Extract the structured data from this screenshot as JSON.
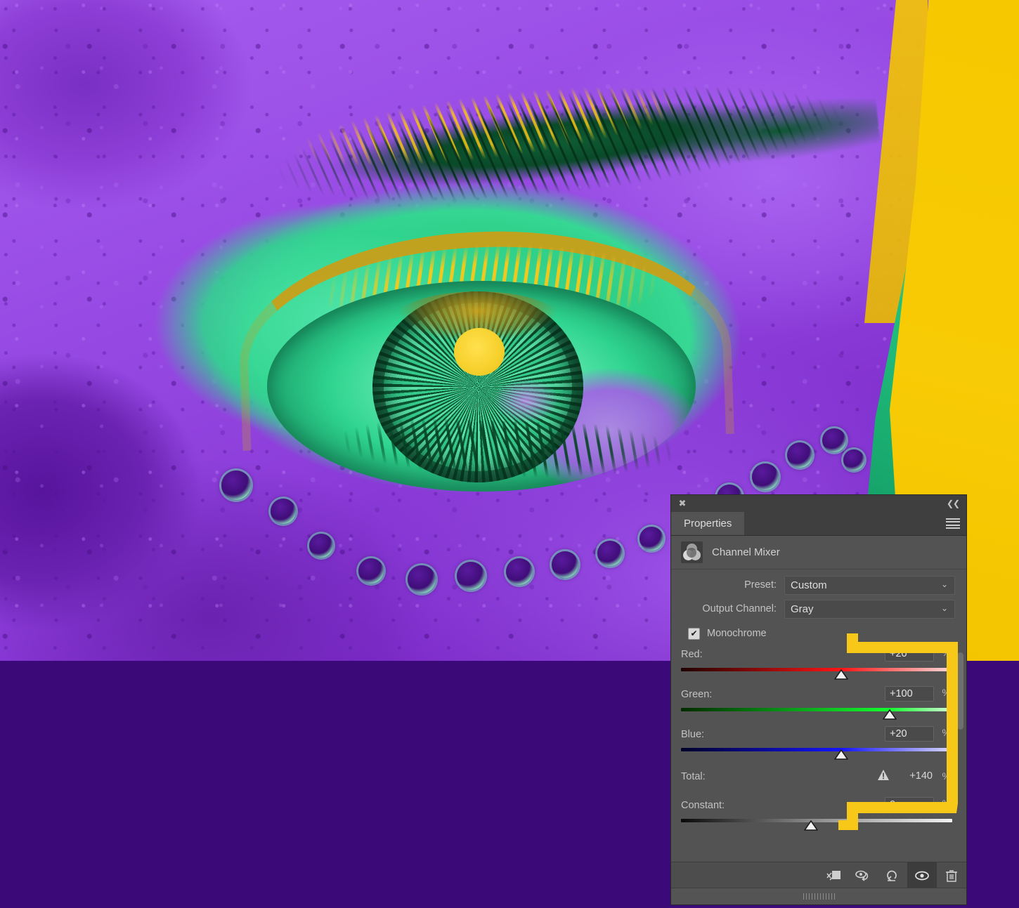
{
  "app": {
    "panel_title": "Properties",
    "close_icon": "✖",
    "collapse_icon": "❮❮",
    "menu_icon": "hamburger-menu-icon"
  },
  "adjustment": {
    "name": "Channel Mixer",
    "icon": "channel-mixer-venn-icon"
  },
  "fields": {
    "preset_label": "Preset:",
    "preset_value": "Custom",
    "output_channel_label": "Output Channel:",
    "output_channel_value": "Gray",
    "chevron": "⌄"
  },
  "monochrome": {
    "label": "Monochrome",
    "checked": true,
    "check_glyph": "✔"
  },
  "sliders": [
    {
      "label": "Red:",
      "value": "+20",
      "unit": "%",
      "percent": 59,
      "color": "#ff2b2b"
    },
    {
      "label": "Green:",
      "value": "+100",
      "unit": "%",
      "percent": 77,
      "color": "#1aff3c"
    },
    {
      "label": "Blue:",
      "value": "+20",
      "unit": "%",
      "percent": 59,
      "color": "#2b2bff"
    }
  ],
  "total": {
    "label": "Total:",
    "value": "+140",
    "unit": "%",
    "warning_icon": "warning-triangle-icon"
  },
  "constant": {
    "label": "Constant:",
    "value": "0",
    "unit": "%",
    "percent": 48
  },
  "footer_buttons": [
    {
      "name": "clip-to-layer-button",
      "icon": "clip-to-layer-icon"
    },
    {
      "name": "view-previous-state-button",
      "icon": "eye-arrow-icon"
    },
    {
      "name": "reset-button",
      "icon": "reset-arrow-icon"
    },
    {
      "name": "toggle-visibility-button",
      "icon": "eye-icon",
      "active": true
    },
    {
      "name": "delete-layer-button",
      "icon": "trash-icon"
    }
  ],
  "annotation": {
    "shape": "yellow-callout-bracket",
    "color": "#f8c819"
  },
  "image": {
    "subject": "close-up-eye-photo",
    "palette": {
      "purple": "#9a4ee6",
      "dark_purple": "#3b0a78",
      "green": "#2fd48f",
      "yellow": "#f6c800"
    }
  }
}
